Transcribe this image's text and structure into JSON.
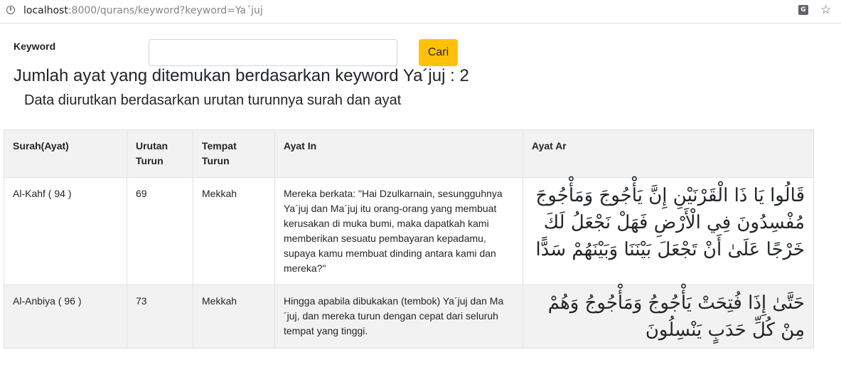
{
  "browser": {
    "url_host": "localhost",
    "url_rest": ":8000/qurans/keyword?keyword=Ya´juj"
  },
  "form": {
    "keyword_label": "Keyword",
    "keyword_value": "",
    "search_button": "Cari"
  },
  "result_title": "Jumlah ayat yang ditemukan berdasarkan keyword Ya´juj : 2",
  "sort_note": "Data diurutkan berdasarkan urutan turunnya surah dan ayat",
  "table": {
    "headers": [
      "Surah(Ayat)",
      "Urutan Turun",
      "Tempat Turun",
      "Ayat In",
      "Ayat Ar"
    ],
    "rows": [
      {
        "surah": "Al-Kahf ( 94 )",
        "urutan": "69",
        "tempat": "Mekkah",
        "ayat_in": "Mereka berkata: \"Hai Dzulkarnain, sesungguhnya Ya´juj dan Ma´juj itu orang-orang yang membuat kerusakan di muka bumi, maka dapatkah kami memberikan sesuatu pembayaran kepadamu, supaya kamu membuat dinding antara kami dan mereka?\"",
        "ayat_ar": "قَالُوا يَا ذَا الْقَرْنَيْنِ إِنَّ يَأْجُوجَ وَمَأْجُوجَ مُفْسِدُونَ فِي الْأَرْضِ فَهَلْ نَجْعَلُ لَكَ خَرْجًا عَلَىٰ أَنْ تَجْعَلَ بَيْنَنَا وَبَيْنَهُمْ سَدًّا"
      },
      {
        "surah": "Al-Anbiya ( 96 )",
        "urutan": "73",
        "tempat": "Mekkah",
        "ayat_in": "Hingga apabila dibukakan (tembok) Ya´juj dan Ma´juj, dan mereka turun dengan cepat dari seluruh tempat yang tinggi.",
        "ayat_ar": "حَتَّىٰ إِذَا فُتِحَتْ يَأْجُوجُ وَمَأْجُوجُ وَهُمْ مِنْ كُلِّ حَدَبٍ يَنْسِلُونَ"
      }
    ]
  }
}
